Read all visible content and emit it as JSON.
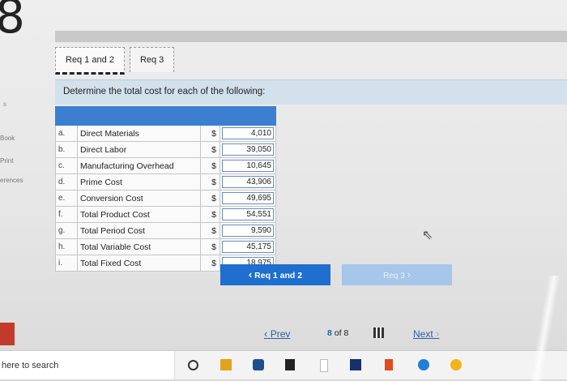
{
  "page_number_glyph": "8",
  "sidebar": {
    "items": [
      "Book",
      "Print",
      "erences"
    ]
  },
  "tabs": [
    {
      "label": "Req 1 and 2",
      "active": true
    },
    {
      "label": "Req 3",
      "active": false
    }
  ],
  "instruction": "Determine the total cost for each of the following:",
  "table": {
    "rows": [
      {
        "letter": "a.",
        "label": "Direct Materials",
        "currency": "$",
        "value": "4,010"
      },
      {
        "letter": "b.",
        "label": "Direct Labor",
        "currency": "$",
        "value": "39,050"
      },
      {
        "letter": "c.",
        "label": "Manufacturing Overhead",
        "currency": "$",
        "value": "10,645"
      },
      {
        "letter": "d.",
        "label": "Prime Cost",
        "currency": "$",
        "value": "43,906"
      },
      {
        "letter": "e.",
        "label": "Conversion Cost",
        "currency": "$",
        "value": "49,695"
      },
      {
        "letter": "f.",
        "label": "Total Product Cost",
        "currency": "$",
        "value": "54,551"
      },
      {
        "letter": "g.",
        "label": "Total Period Cost",
        "currency": "$",
        "value": "9,590"
      },
      {
        "letter": "h.",
        "label": "Total Variable Cost",
        "currency": "$",
        "value": "45,175"
      },
      {
        "letter": "i.",
        "label": "Total Fixed Cost",
        "currency": "$",
        "value": "18,975"
      }
    ]
  },
  "nav_buttons": {
    "prev_label": "Req 1 and 2",
    "next_label": "Req 3"
  },
  "pager": {
    "prev": "Prev",
    "current": "8",
    "of": "of",
    "total": "8",
    "next": "Next"
  },
  "taskbar": {
    "search_text": "here to search"
  },
  "colors": {
    "accent": "#1e6fcf",
    "header": "#3c7fd0",
    "instruction_bg": "#d2e1ec"
  }
}
